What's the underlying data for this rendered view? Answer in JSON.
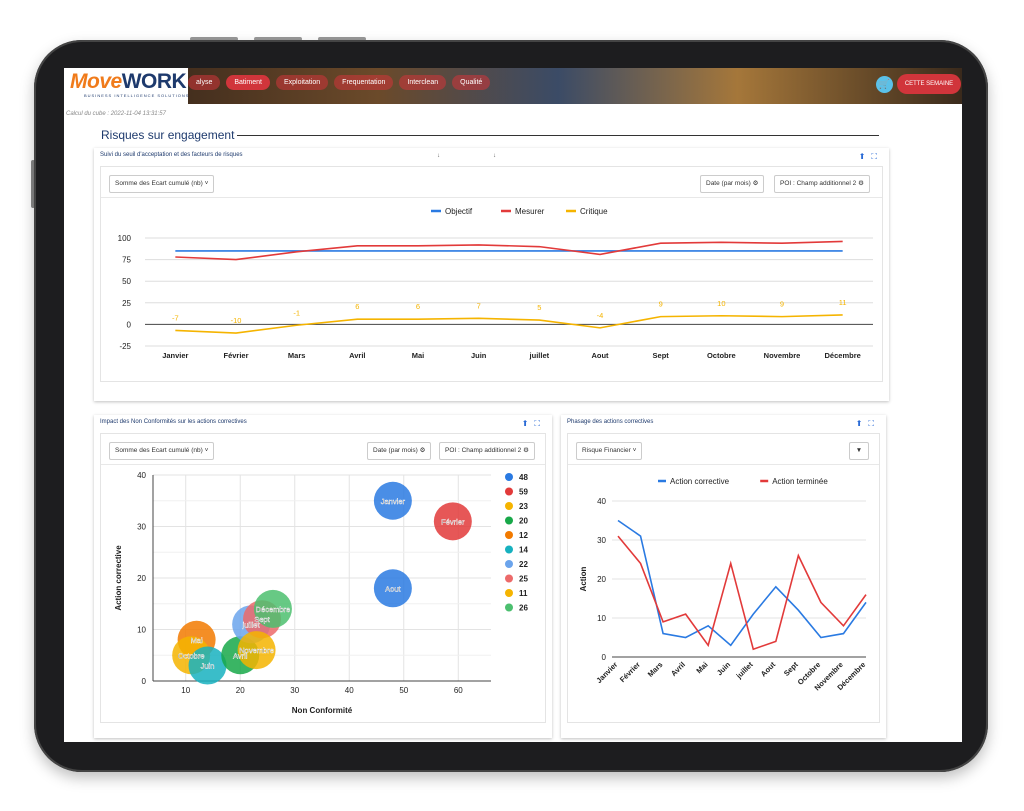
{
  "app": {
    "logo_move": "Move",
    "logo_work": "WORK",
    "logo_sub": "BUSINESS INTELLIGENCE SOLUTIONS",
    "nav": [
      "alyse",
      "Batiment",
      "Exploitation",
      "Frequentation",
      "Interclean",
      "Qualité"
    ],
    "week_button": "CETTE SEMAINE",
    "calc_text": "Calcul du cube : 2022-11-04 13:31:57"
  },
  "section": {
    "title": "Risques sur engagement"
  },
  "card1": {
    "title": "Suivi du seuil d'acceptation et des facteurs de risques",
    "marks": [
      "↓",
      "↓"
    ],
    "dropdown": "Somme des Ecart cumulé (nb)",
    "chip_date": "Date (par mois)",
    "chip_poi": "POI : Champ additionnel 2"
  },
  "card2": {
    "title": "Impact des Non Conformités sur les actions correctives",
    "dropdown": "Somme des Ecart cumulé (nb)",
    "chip_date": "Date (par mois)",
    "chip_poi": "POI : Champ additionnel 2"
  },
  "card3": {
    "title": "Phasage des actions correctives",
    "dropdown": "Risque Financier"
  },
  "colors": {
    "blue": "#2a7ae2",
    "red": "#e23a3a",
    "yellow": "#f5b400",
    "header_red": "#d1353b",
    "title_blue": "#1e3a6d"
  },
  "chart_data": [
    {
      "type": "line",
      "categories": [
        "Janvier",
        "Février",
        "Mars",
        "Avril",
        "Mai",
        "Juin",
        "juillet",
        "Aout",
        "Sept",
        "Octobre",
        "Novembre",
        "Décembre"
      ],
      "series": [
        {
          "name": "Objectif",
          "color": "#2a7ae2",
          "values": [
            85,
            85,
            85,
            85,
            85,
            85,
            85,
            85,
            85,
            85,
            85,
            85
          ]
        },
        {
          "name": "Mesurer",
          "color": "#e23a3a",
          "values": [
            78,
            75,
            84,
            91,
            91,
            92,
            90,
            81,
            94,
            95,
            94,
            96
          ]
        },
        {
          "name": "Critique",
          "color": "#f5b400",
          "values": [
            -7,
            -10,
            -1,
            6,
            6,
            7,
            5,
            -4,
            9,
            10,
            9,
            11
          ],
          "data_labels": true
        }
      ],
      "yticks": [
        100,
        75,
        50,
        25,
        0,
        -25
      ],
      "ylim": [
        -25,
        100
      ],
      "legend": "top-center",
      "grid": true
    },
    {
      "type": "scatter",
      "xlabel": "Non Conformité",
      "ylabel": "Action corrective",
      "xticks": [
        10,
        20,
        30,
        40,
        50,
        60
      ],
      "yticks": [
        0,
        10,
        20,
        30,
        40
      ],
      "xlim": [
        4,
        66
      ],
      "ylim": [
        0,
        40
      ],
      "legend": "right",
      "grid": true,
      "points": [
        {
          "label": "Janvier",
          "x": 48,
          "y": 35,
          "value": 48,
          "color": "#2a7ae2"
        },
        {
          "label": "Février",
          "x": 59,
          "y": 31,
          "value": 59,
          "color": "#e23a3a"
        },
        {
          "label": "Mai",
          "x": 12,
          "y": 8,
          "value": 23,
          "color": "#f27a00"
        },
        {
          "label": "Octobre",
          "x": 11,
          "y": 5,
          "value": 11,
          "color": "#f5b400"
        },
        {
          "label": "Juin",
          "x": 14,
          "y": 3,
          "value": 14,
          "color": "#17b1bf"
        },
        {
          "label": "Avril",
          "x": 20,
          "y": 5,
          "value": 20,
          "color": "#18a849"
        },
        {
          "label": "juillet",
          "x": 22,
          "y": 11,
          "value": 22,
          "color": "#6ba4ec"
        },
        {
          "label": "Sept",
          "x": 24,
          "y": 12,
          "value": 25,
          "color": "#ec6a6a"
        },
        {
          "label": "Décembre",
          "x": 26,
          "y": 14,
          "value": 26,
          "color": "#4cbf6f"
        },
        {
          "label": "Novembre",
          "x": 23,
          "y": 6,
          "value": 12,
          "color": "#f5b400"
        },
        {
          "label": "Aout",
          "x": 48,
          "y": 18,
          "value": 48,
          "color": "#2a7ae2"
        }
      ],
      "legend_items": [
        {
          "label": "48",
          "color": "#2a7ae2"
        },
        {
          "label": "59",
          "color": "#e23a3a"
        },
        {
          "label": "23",
          "color": "#f5b400"
        },
        {
          "label": "20",
          "color": "#18a849"
        },
        {
          "label": "12",
          "color": "#f27a00"
        },
        {
          "label": "14",
          "color": "#17b1bf"
        },
        {
          "label": "22",
          "color": "#6ba4ec"
        },
        {
          "label": "25",
          "color": "#ec6a6a"
        },
        {
          "label": "11",
          "color": "#f5b400"
        },
        {
          "label": "26",
          "color": "#4cbf6f"
        }
      ]
    },
    {
      "type": "line",
      "ylabel": "Action",
      "categories": [
        "Janvier",
        "Février",
        "Mars",
        "Avril",
        "Mai",
        "Juin",
        "juillet",
        "Aout",
        "Sept",
        "Octobre",
        "Novembre",
        "Décembre"
      ],
      "series": [
        {
          "name": "Action corrective",
          "color": "#2a7ae2",
          "values": [
            35,
            31,
            6,
            5,
            8,
            3,
            11,
            18,
            12,
            5,
            6,
            14
          ]
        },
        {
          "name": "Action terminée",
          "color": "#e23a3a",
          "values": [
            31,
            24,
            9,
            11,
            3,
            24,
            2,
            4,
            26,
            14,
            8,
            16
          ]
        }
      ],
      "yticks": [
        0,
        10,
        20,
        30,
        40
      ],
      "ylim": [
        0,
        40
      ],
      "legend": "top-center",
      "grid": true
    }
  ]
}
